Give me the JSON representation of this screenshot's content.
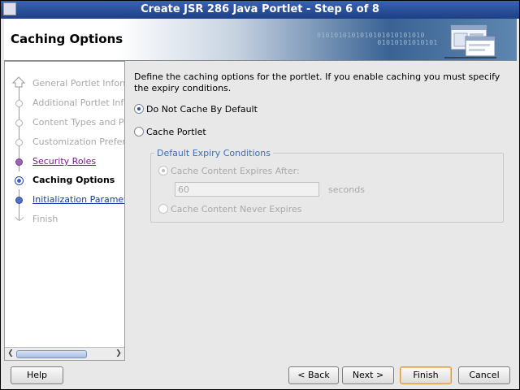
{
  "window": {
    "title": "Create JSR 286 Java Portlet - Step 6 of 8"
  },
  "banner": {
    "title": "Caching Options",
    "binary": "0101010101010101010101010\n01010101010101"
  },
  "nav": {
    "steps": [
      {
        "label": "General Portlet Information",
        "state": "done"
      },
      {
        "label": "Additional Portlet Information",
        "state": "done"
      },
      {
        "label": "Content Types and Portlet Modes",
        "state": "done"
      },
      {
        "label": "Customization Preferences",
        "state": "done"
      },
      {
        "label": "Security Roles",
        "state": "visited"
      },
      {
        "label": "Caching Options",
        "state": "current"
      },
      {
        "label": "Initialization Parameters",
        "state": "link"
      },
      {
        "label": "Finish",
        "state": "disabled"
      }
    ]
  },
  "content": {
    "description": "Define the caching options for the portlet. If you enable caching you must specify the expiry conditions.",
    "options": {
      "no_cache": "Do Not Cache By Default",
      "cache_portlet": "Cache Portlet"
    },
    "expiry": {
      "group_title": "Default Expiry Conditions",
      "expires_after": "Cache Content Expires After:",
      "seconds_value": "60",
      "seconds_unit": "seconds",
      "never_expires": "Cache Content Never Expires"
    }
  },
  "buttons": {
    "help": "Help",
    "back": "< Back",
    "next": "Next >",
    "finish": "Finish",
    "cancel": "Cancel"
  },
  "colors": {
    "title_bar": "#1d3f86",
    "group_title": "#3c6fb4",
    "link": "#1a3aa8",
    "visited": "#7a1a8a"
  }
}
